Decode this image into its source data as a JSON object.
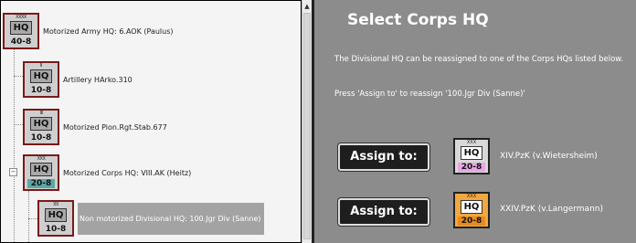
{
  "tree": {
    "nodes": [
      {
        "pips": "XXXX",
        "hq": "HQ",
        "stat": "40-8",
        "label": "Motorized Army HQ: 6.AOK (Paulus)"
      },
      {
        "pips": "II",
        "hq": "HQ",
        "stat": "10-8",
        "label": "Artillery HArko.310"
      },
      {
        "pips": "III",
        "hq": "HQ",
        "stat": "10-8",
        "label": "Motorized Pion.Rgt.Stab.677"
      },
      {
        "pips": "XXX",
        "hq": "HQ",
        "stat": "20-8",
        "label": "Motorized Corps HQ: VIII.AK (Heitz)",
        "expander": "−"
      },
      {
        "pips": "XX",
        "hq": "HQ",
        "stat": "10-8",
        "label": "Non motorized Divisional HQ: 100.Jgr Div (Sanne)"
      }
    ]
  },
  "scrollbar": {
    "up_arrow": "▲"
  },
  "panel": {
    "title": "Select Corps HQ",
    "desc_1": "The Divisional HQ can be reassigned to one of the Corps HQs listed below.",
    "desc_2": "Press 'Assign to' to reassign '100.Jgr Div (Sanne)'",
    "options": [
      {
        "button": "Assign to:",
        "pips": "XXX",
        "hq": "HQ",
        "stat": "20-8",
        "label": "XIV.PzK (v.Wietersheim)",
        "color": "#e7a6e4"
      },
      {
        "button": "Assign to:",
        "pips": "XXX",
        "hq": "HQ",
        "stat": "20-8",
        "label": "XXIV.PzK (v.Langermann)",
        "color": "#e98a1e"
      }
    ]
  }
}
